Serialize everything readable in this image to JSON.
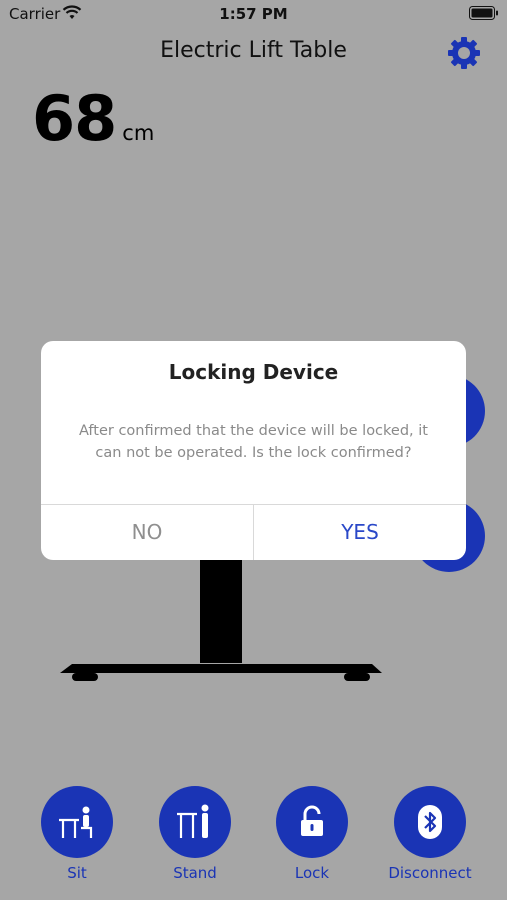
{
  "status_bar": {
    "carrier": "Carrier",
    "time": "1:57 PM"
  },
  "header": {
    "title": "Electric Lift Table",
    "settings_icon": "gear-icon"
  },
  "height": {
    "value": "68",
    "unit": "cm"
  },
  "dialog": {
    "title": "Locking Device",
    "message": "After confirmed that the device will be locked, it can not be operated. Is the lock confirmed?",
    "no_label": "NO",
    "yes_label": "YES"
  },
  "tabs": [
    {
      "label": "Sit",
      "icon": "sit-desk-icon"
    },
    {
      "label": "Stand",
      "icon": "stand-desk-icon"
    },
    {
      "label": "Lock",
      "icon": "unlock-icon"
    },
    {
      "label": "Disconnect",
      "icon": "bluetooth-icon"
    }
  ],
  "colors": {
    "accent": "#1a34b5",
    "overlay": "#a6a6a6",
    "dialog_yes": "#2a48c8"
  }
}
